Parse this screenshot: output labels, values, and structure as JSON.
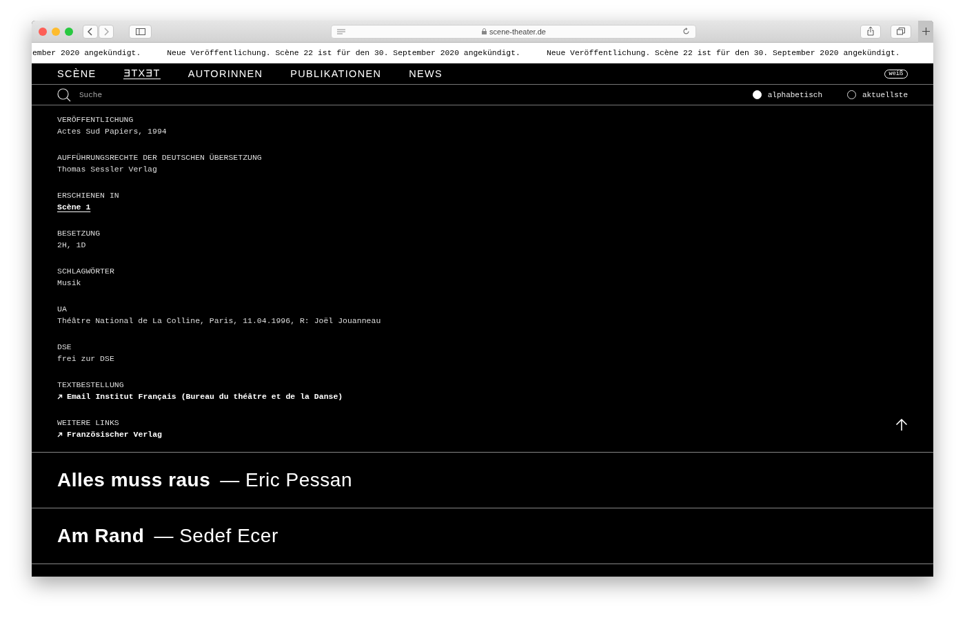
{
  "browser": {
    "url": "scene-theater.de"
  },
  "ticker": [
    "ember 2020 angekündigt.",
    "Neue Veröffentlichung. Scène 22 ist für den 30. September 2020 angekündigt.",
    "Neue Veröffentlichung. Scène 22 ist für den 30. September 2020 angekündigt."
  ],
  "nav": [
    {
      "label": "SCÈNE",
      "selected": false
    },
    {
      "label": "ƎTXƎT",
      "selected": true
    },
    {
      "label": "AUTORINNEN",
      "selected": false
    },
    {
      "label": "PUBLIKATIONEN",
      "selected": false
    },
    {
      "label": "NEWS",
      "selected": false
    }
  ],
  "theme_toggle": "weiß",
  "search": {
    "placeholder": "Suche"
  },
  "sort": [
    {
      "label": "alphabetisch",
      "selected": true
    },
    {
      "label": "aktuellste",
      "selected": false
    }
  ],
  "details": [
    {
      "label": "VERÖFFENTLICHUNG",
      "value": "Actes Sud Papiers, 1994",
      "kind": "text"
    },
    {
      "label": "AUFFÜHRUNGSRECHTE DER DEUTSCHEN ÜBERSETZUNG",
      "value": "Thomas Sessler Verlag",
      "kind": "text"
    },
    {
      "label": "ERSCHIENEN IN",
      "value": "Scène 1",
      "kind": "link"
    },
    {
      "label": "BESETZUNG",
      "value": "2H, 1D",
      "kind": "text"
    },
    {
      "label": "SCHLAGWÖRTER",
      "value": "Musik",
      "kind": "text"
    },
    {
      "label": "UA",
      "value": "Théâtre National de La Colline, Paris, 11.04.1996, R: Joël Jouanneau",
      "kind": "text"
    },
    {
      "label": "DSE",
      "value": "frei zur DSE",
      "kind": "text"
    },
    {
      "label": "TEXTBESTELLUNG",
      "value": "Email Institut Français (Bureau du théâtre et de la Danse)",
      "kind": "external"
    },
    {
      "label": "WEITERE LINKS",
      "value": "Französischer Verlag",
      "kind": "external"
    }
  ],
  "plays": [
    {
      "title": "Alles muss raus",
      "author": "— Eric Pessan"
    },
    {
      "title": "Am Rand",
      "author": "— Sedef Ecer"
    }
  ]
}
